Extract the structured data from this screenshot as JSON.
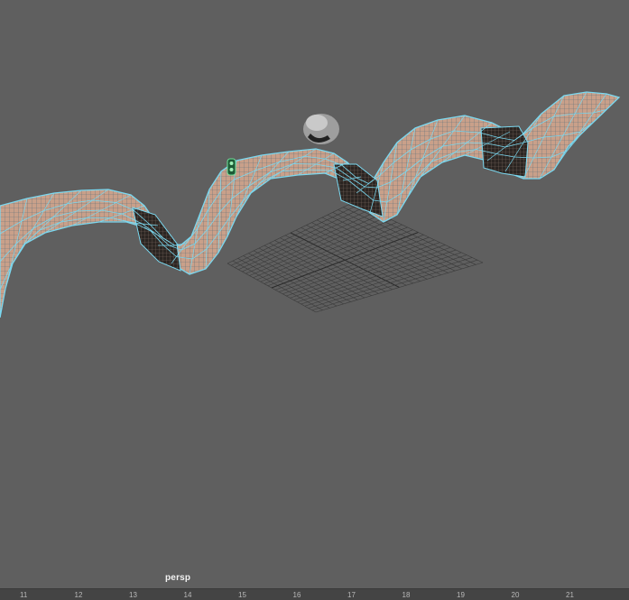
{
  "viewport": {
    "camera_label": "persp",
    "background_color": "#5f5f5f",
    "wireframe_color": "#7ad8f0",
    "surface_color": "#c9a08a",
    "grid_color": "#3a3a3a"
  },
  "objects": [
    {
      "name": "wavy-ribbon-mesh",
      "kind": "nurbs-surface",
      "state": "selected"
    },
    {
      "name": "ground-grid",
      "kind": "grid"
    },
    {
      "name": "sphere-object",
      "kind": "primitive"
    },
    {
      "name": "character-marker",
      "kind": "locator"
    }
  ],
  "timeline": {
    "ticks": [
      "11",
      "12",
      "13",
      "14",
      "15",
      "16",
      "17",
      "18",
      "19",
      "20",
      "21"
    ]
  }
}
